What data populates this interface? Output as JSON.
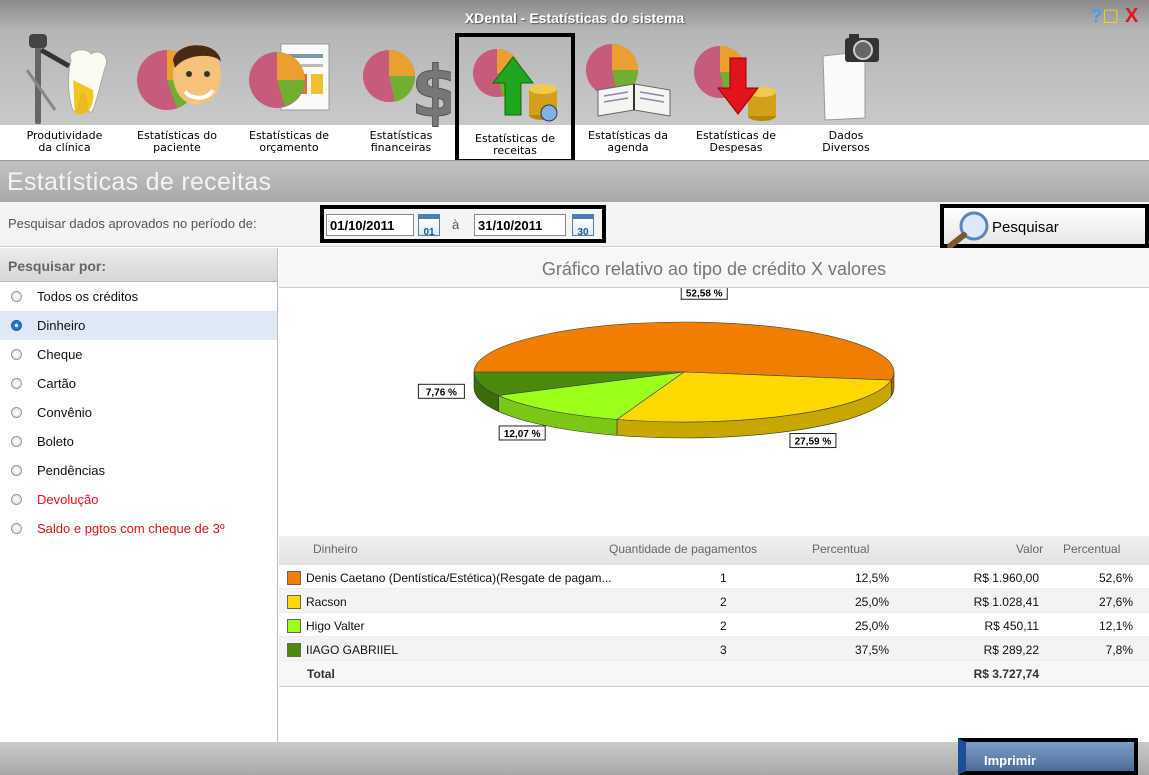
{
  "window": {
    "title": "XDental - Estatísticas do sistema",
    "help": "?",
    "maximize": "□",
    "close": "X"
  },
  "toolbar": {
    "items": [
      {
        "label1": "Produtividade",
        "label2": "da clínica"
      },
      {
        "label1": "Estatísticas do",
        "label2": "paciente"
      },
      {
        "label1": "Estatísticas de",
        "label2": "orçamento"
      },
      {
        "label1": "Estatísticas",
        "label2": "financeiras"
      },
      {
        "label1": "Estatísticas de",
        "label2": "receitas"
      },
      {
        "label1": "Estatísticas da",
        "label2": "agenda"
      },
      {
        "label1": "Estatísticas de",
        "label2": "Despesas"
      },
      {
        "label1": "Dados",
        "label2": "Diversos"
      }
    ]
  },
  "page": {
    "title": "Estatísticas de receitas"
  },
  "filter": {
    "label": "Pesquisar dados aprovados no período de:",
    "date_from": "01/10/2011",
    "cal_from": "01",
    "separator": "à",
    "date_to": "31/10/2011",
    "cal_to": "30",
    "search_button": "Pesquisar"
  },
  "sidebar": {
    "header": "Pesquisar por:",
    "options": [
      {
        "label": "Todos os créditos"
      },
      {
        "label": "Dinheiro"
      },
      {
        "label": "Cheque"
      },
      {
        "label": "Cartão"
      },
      {
        "label": "Convênio"
      },
      {
        "label": "Boleto"
      },
      {
        "label": "Pendências"
      },
      {
        "label": "Devolução"
      },
      {
        "label": "Saldo e pgtos com cheque de 3º"
      }
    ],
    "selected": "Dinheiro"
  },
  "chart_title": "Gráfico relativo ao tipo de crédito X valores",
  "chart_data": {
    "type": "pie",
    "title": "Gráfico relativo ao tipo de crédito X valores",
    "categories": [
      "Denis Caetano (Dentística/Estética)(Resgate de pagam...",
      "Racson",
      "Higo Valter",
      "IIAGO GABRIIEL"
    ],
    "values": [
      52.58,
      27.59,
      12.07,
      7.76
    ],
    "labels": [
      "52,58 %",
      "27,59 %",
      "12,07 %",
      "7,76 %"
    ],
    "colors": [
      "#f07f00",
      "#ffd800",
      "#9dff1c",
      "#4b8a0b"
    ]
  },
  "table": {
    "headers": {
      "name": "Dinheiro",
      "qty": "Quantidade de pagamentos",
      "pct1": "Percentual",
      "value": "Valor",
      "pct2": "Percentual"
    },
    "rows": [
      {
        "name": "Denis Caetano (Dentística/Estética)(Resgate de pagam...",
        "qty": "1",
        "pct1": "12,5%",
        "value": "R$ 1.960,00",
        "pct2": "52,6%"
      },
      {
        "name": "Racson",
        "qty": "2",
        "pct1": "25,0%",
        "value": "R$ 1.028,41",
        "pct2": "27,6%"
      },
      {
        "name": "Higo Valter",
        "qty": "2",
        "pct1": "25,0%",
        "value": "R$ 450,11",
        "pct2": "12,1%"
      },
      {
        "name": "IIAGO GABRIIEL",
        "qty": "3",
        "pct1": "37,5%",
        "value": "R$ 289,22",
        "pct2": "7,8%"
      }
    ],
    "total": {
      "label": "Total",
      "value": "R$ 3.727,74"
    }
  },
  "print_button": "Imprimir"
}
